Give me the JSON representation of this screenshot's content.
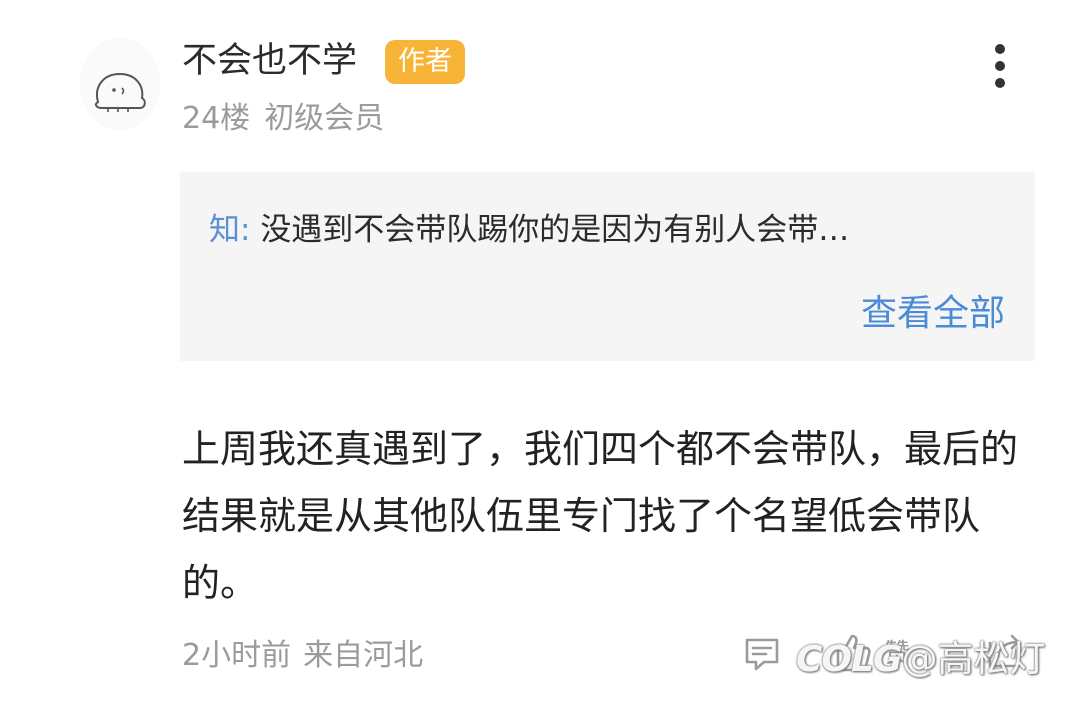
{
  "post": {
    "username": "不会也不学",
    "author_badge": "作者",
    "floor": "24楼",
    "member_level": "初级会员",
    "quote": {
      "author": "知:",
      "text": "没遇到不会带队踢你的是因为有别人会带…",
      "view_all_label": "查看全部"
    },
    "body": "上周我还真遇到了，我们四个都不会带队，最后的结果就是从其他队伍里专门找了个名望低会带队的。",
    "time": "2小时前",
    "location": "来自河北",
    "like_label": "赞"
  },
  "icons": {
    "avatar": "cartoon-avatar",
    "more": "more-vertical-icon",
    "comment": "comment-icon",
    "like": "thumbs-up-icon",
    "share": "share-icon"
  },
  "colors": {
    "badge": "#f7b436",
    "link": "#4a8ad8",
    "quote_bg": "#f5f5f5",
    "meta": "#9b9b9b"
  },
  "watermark": {
    "logo": "COLG",
    "handle": "@高松灯"
  }
}
